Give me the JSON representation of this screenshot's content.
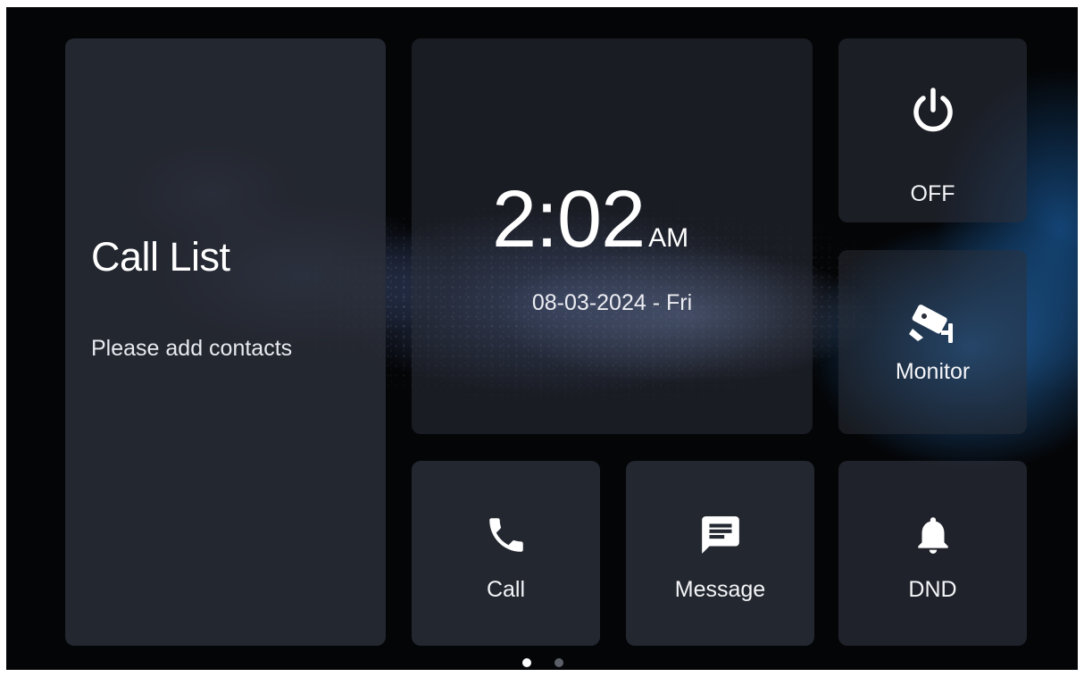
{
  "call_list": {
    "title": "Call List",
    "subtitle": "Please add contacts"
  },
  "clock": {
    "time": "2:02",
    "period": "AM",
    "date": "08-03-2024 - Fri"
  },
  "tiles": {
    "power": {
      "label": "OFF",
      "icon": "power-icon"
    },
    "monitor": {
      "label": "Monitor",
      "icon": "camera-icon"
    },
    "call": {
      "label": "Call",
      "icon": "phone-icon"
    },
    "message": {
      "label": "Message",
      "icon": "message-icon"
    },
    "dnd": {
      "label": "DND",
      "icon": "bell-icon"
    }
  },
  "pager": {
    "page_count": 2,
    "active_page": 1
  },
  "colors": {
    "tile_bg": "#2c2f3a",
    "text": "#ffffff",
    "accent_blue": "#2878c8",
    "dot_inactive": "#5b5f68"
  }
}
